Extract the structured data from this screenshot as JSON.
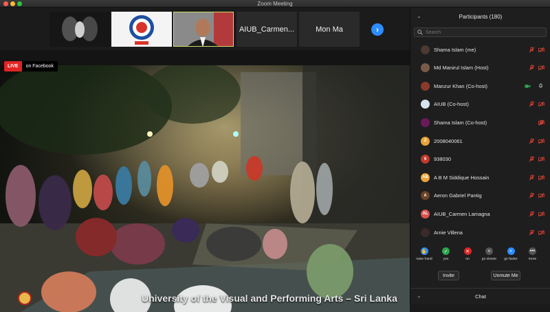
{
  "window": {
    "title": "Zoom Meeting"
  },
  "gallery": {
    "tiles": [
      {
        "name": "",
        "kind": "image-dark"
      },
      {
        "name": "",
        "kind": "logo"
      },
      {
        "name": "",
        "kind": "video"
      },
      {
        "name": "AIUB_Carmen...",
        "kind": "name"
      },
      {
        "name": "Mon Ma",
        "kind": "name"
      }
    ],
    "next_icon": "chevron-right-icon"
  },
  "live": {
    "badge": "LIVE",
    "text": "on Facebook"
  },
  "video": {
    "caption": "University of the Visual and Performing Arts – Sri Lanka"
  },
  "panel": {
    "title": "Participants (180)",
    "search_placeholder": "Search",
    "participants": [
      {
        "name": "Shama Islam (me)",
        "avatar_color": "#4a3a30",
        "initials": "",
        "video": "off",
        "mic": "muted"
      },
      {
        "name": "Md Manirul Islam (Host)",
        "avatar_color": "#7a5a48",
        "initials": "",
        "video": "off",
        "mic": "muted"
      },
      {
        "name": "Manzur Khan (Co-host)",
        "avatar_color": "#8a3a2a",
        "initials": "",
        "video": "on",
        "mic": "on"
      },
      {
        "name": "AIUB (Co-host)",
        "avatar_color": "#d6e4f0",
        "initials": "",
        "video": "off",
        "mic": "muted"
      },
      {
        "name": "Shama Islam (Co-host)",
        "avatar_color": "#6a1a5a",
        "initials": "",
        "video": "off",
        "mic": "none"
      },
      {
        "name": "2008040061",
        "avatar_color": "#e8a33a",
        "initials": "2",
        "video": "off",
        "mic": "muted"
      },
      {
        "name": "938030",
        "avatar_color": "#c0392b",
        "initials": "9",
        "video": "off",
        "mic": "muted"
      },
      {
        "name": "A B M Siddique Hossain",
        "avatar_color": "#e8a33a",
        "initials": "AB",
        "video": "off",
        "mic": "muted"
      },
      {
        "name": "Aeron Gabriel Pantig",
        "avatar_color": "#6b4226",
        "initials": "A",
        "video": "off",
        "mic": "muted"
      },
      {
        "name": "AIUB_Carmen Lamagna",
        "avatar_color": "#d9534f",
        "initials": "AL",
        "video": "off",
        "mic": "muted"
      },
      {
        "name": "Arnie Villena",
        "avatar_color": "#3a2a2a",
        "initials": "",
        "video": "off",
        "mic": "muted"
      }
    ],
    "reactions": [
      {
        "label": "raise hand",
        "color": "#2d8cff",
        "icon": "hand-icon",
        "glyph": "✋"
      },
      {
        "label": "yes",
        "color": "#2ea44f",
        "icon": "check-icon",
        "glyph": "✓"
      },
      {
        "label": "no",
        "color": "#e02424",
        "icon": "x-icon",
        "glyph": "✕"
      },
      {
        "label": "go slower",
        "color": "#555555",
        "icon": "rewind-icon",
        "glyph": "«"
      },
      {
        "label": "go faster",
        "color": "#2d8cff",
        "icon": "fast-forward-icon",
        "glyph": "»"
      },
      {
        "label": "more",
        "color": "#555555",
        "icon": "more-icon",
        "glyph": "•••"
      }
    ],
    "invite_label": "Invite",
    "unmute_label": "Unmute Me",
    "chat_label": "Chat"
  }
}
